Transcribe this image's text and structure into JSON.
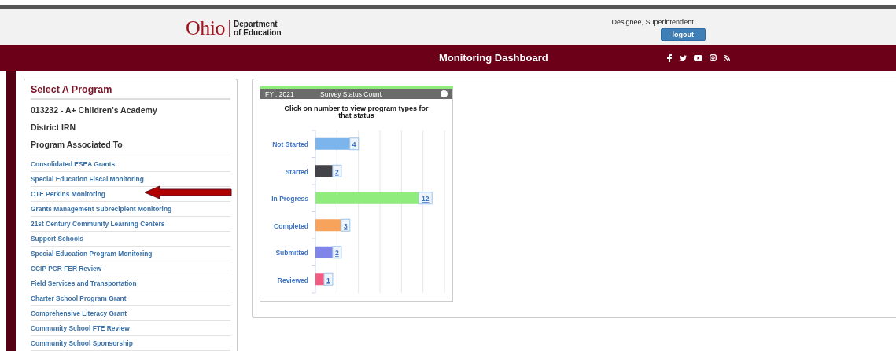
{
  "header": {
    "logo_word": "Ohio",
    "logo_sub_1": "Department",
    "logo_sub_2": "of Education",
    "user": "Designee, Superintendent",
    "logout": "logout"
  },
  "nav": {
    "title": "Monitoring Dashboard"
  },
  "program_panel": {
    "title": "Select A Program",
    "program": "013232 - A+ Children's Academy",
    "district_label": "District IRN",
    "associated_label": "Program Associated To",
    "links": [
      "Consolidated ESEA Grants",
      "Special Education Fiscal Monitoring",
      "CTE Perkins Monitoring",
      "Grants Management Subrecipient Monitoring",
      "21st Century Community Learning Centers",
      "Support Schools",
      "Special Education Program Monitoring",
      "CCIP PCR FER Review",
      "Field Services and Transportation",
      "Charter School Program Grant",
      "Comprehensive Literacy Grant",
      "Community School FTE Review",
      "Community School Sponsorship"
    ]
  },
  "status_card": {
    "fy": "FY : 2021",
    "title": "Survey Status Count",
    "info": "i",
    "instruction": "Click on number to view program types for that status",
    "chart_data": {
      "type": "bar",
      "orientation": "horizontal",
      "categories": [
        "Not Started",
        "Started",
        "In Progress",
        "Completed",
        "Submitted",
        "Reviewed"
      ],
      "series": [
        {
          "color": "#7cb5ec",
          "values": [
            4,
            null,
            null,
            null,
            null,
            null
          ]
        },
        {
          "color": "#434348",
          "values": [
            null,
            2,
            null,
            null,
            null,
            null
          ]
        },
        {
          "color": "#90ed7d",
          "values": [
            null,
            null,
            12,
            null,
            null,
            null
          ]
        },
        {
          "color": "#f7a35c",
          "values": [
            null,
            null,
            null,
            3,
            null,
            null
          ]
        },
        {
          "color": "#8085e9",
          "values": [
            null,
            null,
            null,
            null,
            2,
            null
          ]
        },
        {
          "color": "#f15c80",
          "values": [
            null,
            null,
            null,
            null,
            null,
            1
          ]
        }
      ],
      "data_labels": true
    }
  }
}
